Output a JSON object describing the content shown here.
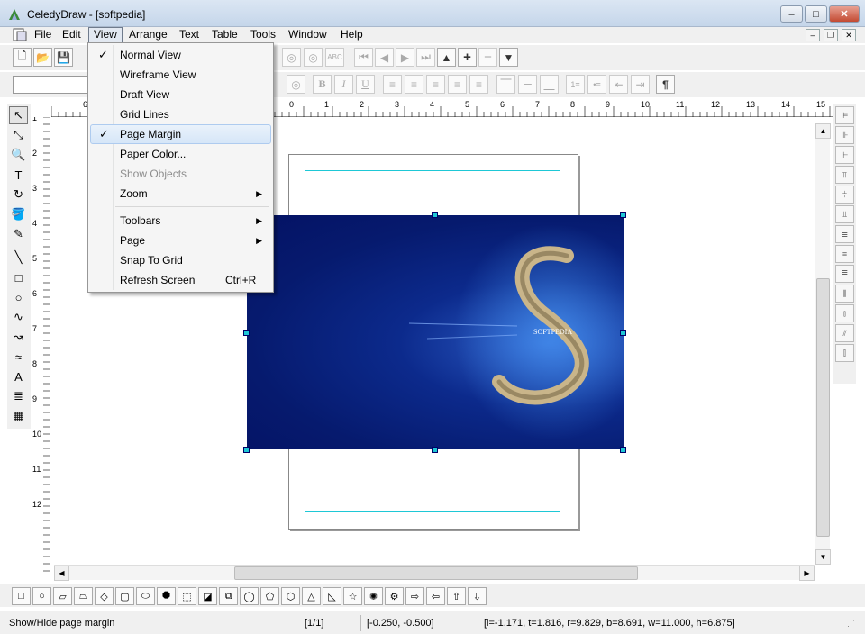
{
  "window": {
    "title": "CeledyDraw - [softpedia]",
    "buttons": {
      "minimize": "–",
      "maximize": "□",
      "close": "✕"
    }
  },
  "menubar": {
    "items": [
      "File",
      "Edit",
      "View",
      "Arrange",
      "Text",
      "Table",
      "Tools",
      "Window",
      "Help"
    ],
    "mdi_buttons": [
      "–",
      "❐",
      "✕"
    ]
  },
  "toolbar1": {
    "icons": [
      "new-icon",
      "open-icon",
      "save-icon",
      "fill-pattern-icon",
      "text-on-path-icon",
      "spell-check-icon",
      "first-page-icon",
      "prev-page-icon",
      "next-page-icon",
      "last-page-icon",
      "page-up-icon",
      "add-page-icon",
      "remove-page-icon",
      "page-down-icon"
    ],
    "glyphs": [
      "🗋",
      "📂",
      "💾",
      "◎",
      "◎",
      "ABC",
      "⏮",
      "◀",
      "▶",
      "⏭",
      "▲",
      "+",
      "−",
      "▼"
    ]
  },
  "toolbar2": {
    "font_value": "",
    "format_glyphs": [
      "B",
      "I",
      "U",
      "≡",
      "≡",
      "≡",
      "≡",
      "≡",
      "⎺",
      "═",
      "⎽",
      "1≡",
      "•≡",
      "⇤",
      "⇥",
      "¶"
    ]
  },
  "view_menu": {
    "items": [
      {
        "label": "Normal View",
        "checked": true,
        "disabled": false,
        "submenu": false,
        "shortcut": ""
      },
      {
        "label": "Wireframe View",
        "checked": false,
        "disabled": false,
        "submenu": false,
        "shortcut": ""
      },
      {
        "label": "Draft View",
        "checked": false,
        "disabled": false,
        "submenu": false,
        "shortcut": ""
      },
      {
        "label": "Grid Lines",
        "checked": false,
        "disabled": false,
        "submenu": false,
        "shortcut": ""
      },
      {
        "label": "Page Margin",
        "checked": true,
        "disabled": false,
        "submenu": false,
        "shortcut": "",
        "highlighted": true
      },
      {
        "label": "Paper Color...",
        "checked": false,
        "disabled": false,
        "submenu": false,
        "shortcut": ""
      },
      {
        "label": "Show  Objects",
        "checked": false,
        "disabled": true,
        "submenu": false,
        "shortcut": ""
      },
      {
        "label": "Zoom",
        "checked": false,
        "disabled": false,
        "submenu": true,
        "shortcut": ""
      },
      {
        "label": "Toolbars",
        "checked": false,
        "disabled": false,
        "submenu": true,
        "shortcut": ""
      },
      {
        "label": "Page",
        "checked": false,
        "disabled": false,
        "submenu": true,
        "shortcut": ""
      },
      {
        "label": "Snap To Grid",
        "checked": false,
        "disabled": false,
        "submenu": false,
        "shortcut": ""
      },
      {
        "label": "Refresh Screen",
        "checked": false,
        "disabled": false,
        "submenu": false,
        "shortcut": "Ctrl+R"
      }
    ],
    "check_glyph": "✓",
    "arrow_glyph": "▶"
  },
  "ruler": {
    "h_labels": [
      "6",
      "0",
      "1",
      "2",
      "3",
      "4",
      "5",
      "6",
      "7",
      "8",
      "9",
      "10",
      "11",
      "12",
      "13",
      "14",
      "15"
    ],
    "v_labels": [
      "1",
      "2",
      "3",
      "4",
      "5",
      "6",
      "7",
      "8",
      "9",
      "10",
      "11",
      "12"
    ]
  },
  "left_tools": {
    "icons": [
      "select-arrow-icon",
      "node-edit-icon",
      "zoom-icon",
      "text-tool-icon",
      "rotate-icon",
      "fill-bucket-icon",
      "pen-icon",
      "line-icon",
      "rectangle-icon",
      "ellipse-icon",
      "curve-icon",
      "bezier-icon",
      "freehand-icon",
      "art-text-icon",
      "paragraph-icon",
      "table-icon"
    ],
    "glyphs": [
      "↖",
      "⤡",
      "🔍",
      "T",
      "↻",
      "🪣",
      "✎",
      "╲",
      "□",
      "○",
      "∿",
      "↝",
      "≈",
      "A",
      "≣",
      "▦"
    ]
  },
  "right_tools": {
    "icons": [
      "align-left-icon",
      "align-center-h-icon",
      "align-right-icon",
      "align-top-icon",
      "align-middle-icon",
      "align-bottom-icon",
      "distribute-top-icon",
      "distribute-middle-icon",
      "distribute-bottom-icon",
      "distribute-left-icon",
      "distribute-center-icon",
      "distribute-right-icon",
      "space-h-icon"
    ],
    "glyphs": [
      "⊫",
      "⊪",
      "⊩",
      "⫪",
      "⫩",
      "⫫",
      "≣",
      "≡",
      "≣",
      "⫼",
      "⫾",
      "⫽",
      "⫿"
    ]
  },
  "bottom_tools": {
    "icons": [
      "rect-shape-icon",
      "circle-shape-icon",
      "parallelogram-icon",
      "trapezoid-icon",
      "diamond-icon",
      "rounded-rect-icon",
      "stadium-icon",
      "octagon-icon",
      "snip-rect-icon",
      "folded-corner-icon",
      "cube-icon",
      "callout-icon",
      "pentagon-arrow-icon",
      "hexagon-icon",
      "triangle-icon",
      "right-triangle-icon",
      "star-icon",
      "seal-icon",
      "gear-shape-icon",
      "arrow-right-icon",
      "arrow-left-icon",
      "arrow-up-icon",
      "arrow-down-icon"
    ],
    "glyphs": [
      "□",
      "○",
      "▱",
      "⏢",
      "◇",
      "▢",
      "⬭",
      "⯃",
      "⬚",
      "◪",
      "⧉",
      "◯",
      "⬠",
      "⬡",
      "△",
      "◺",
      "☆",
      "✺",
      "⚙",
      "⇨",
      "⇦",
      "⇧",
      "⇩"
    ]
  },
  "statusbar": {
    "hint": "Show/Hide page margin",
    "page": "[1/1]",
    "cursor": "[-0.250, -0.500]",
    "selection": "[l=-1.171, t=1.816, r=9.829, b=8.691, w=11.000, h=6.875]"
  },
  "image": {
    "caption": "SOFTPEDIA"
  },
  "colors": {
    "margin_line": "#1ec8d6",
    "handle": "#1ec8d6",
    "image_bg": "#0c2a8c"
  }
}
